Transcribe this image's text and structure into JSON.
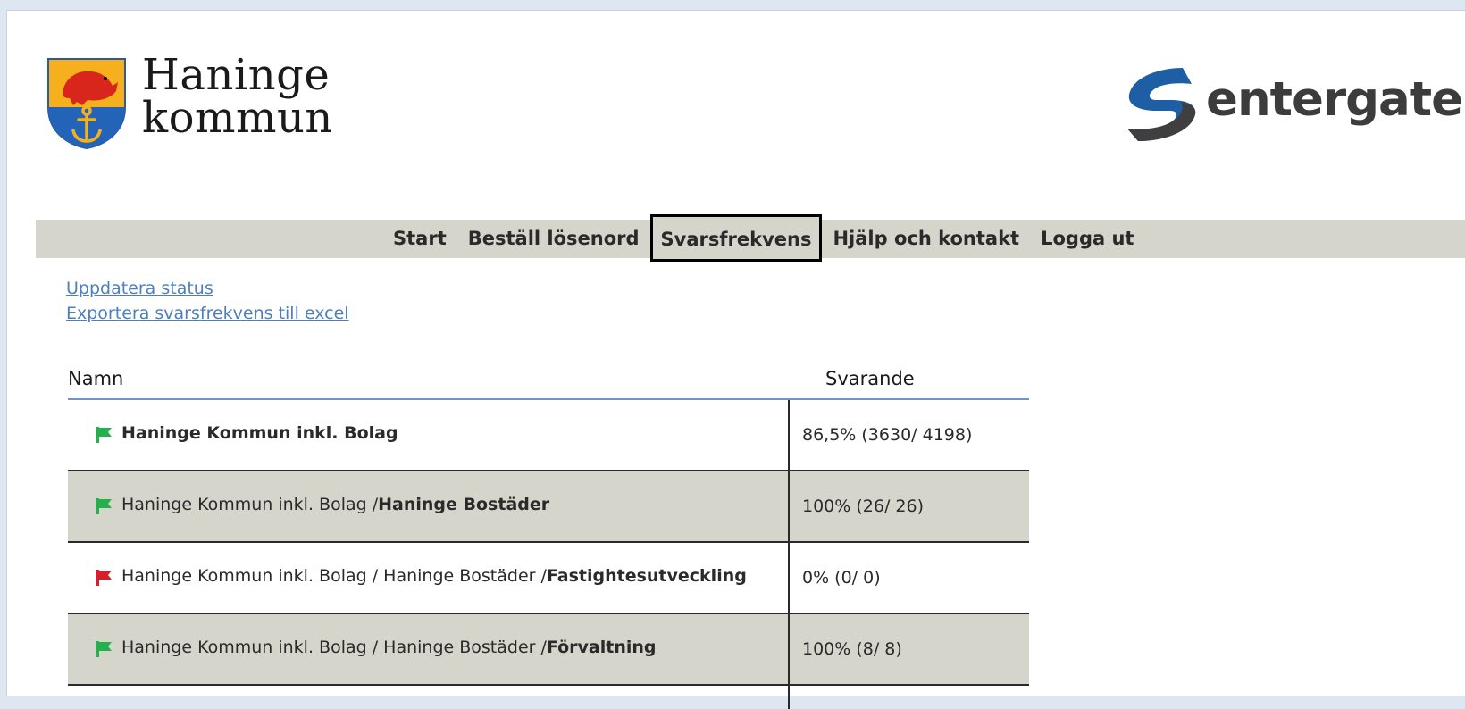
{
  "header": {
    "org_logo": {
      "line1": "Haninge",
      "line2": "kommun"
    },
    "vendor_logo": {
      "name": "entergate"
    }
  },
  "nav": {
    "items": [
      {
        "label": "Start",
        "active": false
      },
      {
        "label": "Beställ lösenord",
        "active": false
      },
      {
        "label": "Svarsfrekvens",
        "active": true
      },
      {
        "label": "Hjälp och kontakt",
        "active": false
      },
      {
        "label": "Logga ut",
        "active": false
      }
    ]
  },
  "actions": {
    "refresh_link": "Uppdatera status",
    "export_link": "Exportera svarsfrekvens till excel"
  },
  "table": {
    "columns": {
      "name": "Namn",
      "responders": "Svarande"
    },
    "rows": [
      {
        "prefix": "",
        "name": "Haninge Kommun inkl. Bolag",
        "status": "green",
        "responders": "86,5% (3630/ 4198)",
        "shaded": false
      },
      {
        "prefix": "Haninge Kommun inkl. Bolag /",
        "name": "Haninge Bostäder",
        "status": "green",
        "responders": "100% (26/ 26)",
        "shaded": true
      },
      {
        "prefix": "Haninge Kommun inkl. Bolag / Haninge Bostäder /",
        "name": "Fastightesutveckling",
        "status": "red",
        "responders": "0% (0/ 0)",
        "shaded": false
      },
      {
        "prefix": "Haninge Kommun inkl. Bolag / Haninge Bostäder /",
        "name": "Förvaltning",
        "status": "green",
        "responders": "100% (8/ 8)",
        "shaded": true
      }
    ]
  },
  "colors": {
    "flag_green": "#22b14c",
    "flag_red": "#d81e2a",
    "link": "#4a7fc0",
    "nav_bg": "#d5d5cc",
    "header_rule": "#6f93c9"
  }
}
